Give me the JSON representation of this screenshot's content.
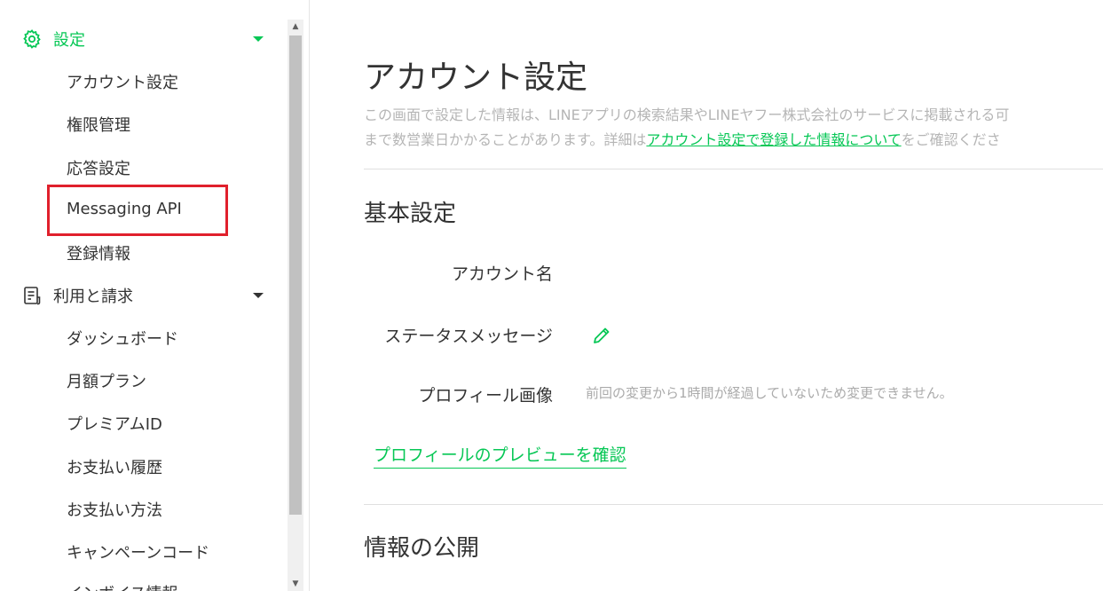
{
  "sidebar": {
    "settings_group": {
      "label": "設定",
      "icon": "gear-icon"
    },
    "settings_items": [
      {
        "label": "アカウント設定"
      },
      {
        "label": "権限管理"
      },
      {
        "label": "応答設定"
      },
      {
        "label": "Messaging API"
      },
      {
        "label": "登録情報"
      }
    ],
    "billing_group": {
      "label": "利用と請求",
      "icon": "document-icon"
    },
    "billing_items": [
      {
        "label": "ダッシュボード"
      },
      {
        "label": "月額プラン"
      },
      {
        "label": "プレミアムID"
      },
      {
        "label": "お支払い履歴"
      },
      {
        "label": "お支払い方法"
      },
      {
        "label": "キャンペーンコード"
      },
      {
        "label": "インボイス情報"
      }
    ],
    "highlighted_item": "Messaging API"
  },
  "main": {
    "title": "アカウント設定",
    "description_line1": "この画面で設定した情報は、LINEアプリの検索結果やLINEヤフー株式会社のサービスに掲載される可",
    "description_line2_prefix": "まで数営業日かかることがあります。詳細は",
    "description_link": "アカウント設定で登録した情報について",
    "description_line2_suffix": "をご確認くださ",
    "basic_section": {
      "title": "基本設定",
      "account_name_label": "アカウント名",
      "status_message_label": "ステータスメッセージ",
      "profile_image_label": "プロフィール画像",
      "profile_image_note": "前回の変更から1時間が経過していないため変更できません。",
      "preview_link": "プロフィールのプレビューを確認"
    },
    "publish_section": {
      "title": "情報の公開"
    }
  },
  "colors": {
    "accent": "#06c755",
    "highlight": "#e0202c",
    "muted_text": "#b5b5b5"
  }
}
